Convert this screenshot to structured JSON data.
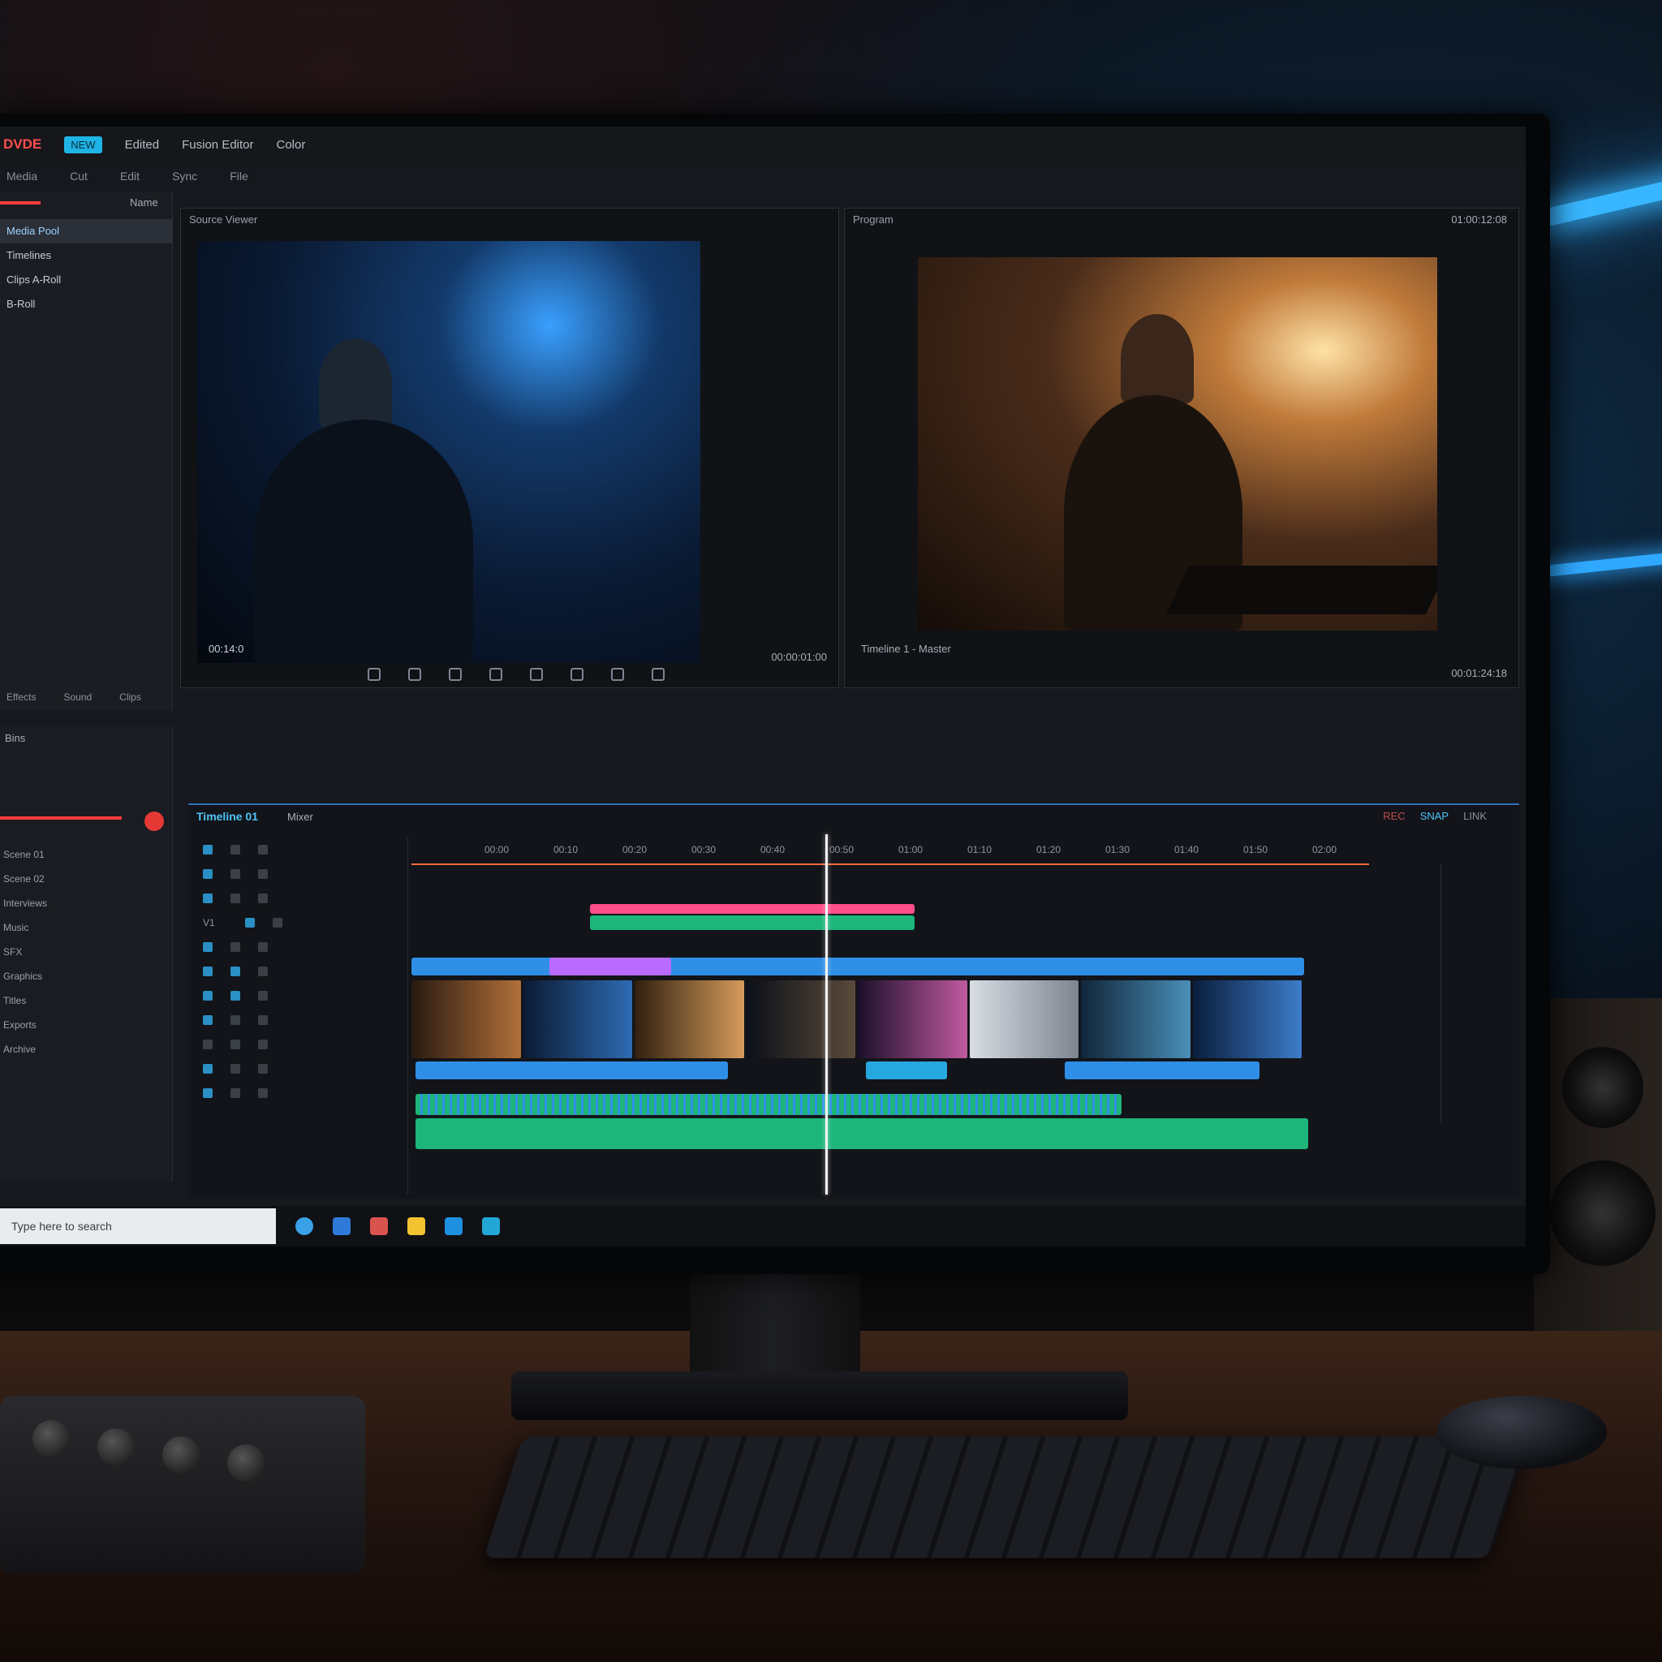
{
  "app": {
    "logo": "DVDE",
    "badge": "NEW",
    "menu": [
      "Edited",
      "Fusion Editor",
      "Color"
    ],
    "submenu": [
      "Media",
      "Cut",
      "Edit",
      "Sync",
      "File"
    ]
  },
  "left_panel": {
    "header": "Name",
    "items": [
      "Media Pool",
      "Timelines",
      "Clips A-Roll",
      "B-Roll"
    ],
    "bottom_tabs": [
      "Effects",
      "Sound",
      "Clips"
    ]
  },
  "source_viewer": {
    "title": "Source Viewer",
    "timecode": "00:14:0",
    "footer": "00:00:01:00"
  },
  "program_viewer": {
    "title": "Program",
    "timecode_top": "01:00:12:08",
    "footer_left": "Timeline 1 - Master",
    "footer_right": "00:01:24:18"
  },
  "timeline": {
    "tab_active": "Timeline 01",
    "tab_other": "Mixer",
    "track_label": "V1",
    "ruler_ticks": [
      "00:00",
      "00:10",
      "00:20",
      "00:30",
      "00:40",
      "00:50",
      "01:00",
      "01:10",
      "01:20",
      "01:30",
      "01:40",
      "01:50",
      "02:00"
    ],
    "tools": [
      "REC",
      "SNAP",
      "LINK"
    ],
    "clip_colors": {
      "pink": "#ff4f8b",
      "green": "#1db57a",
      "blue": "#2f8fe6",
      "purple": "#b96bff",
      "cyan": "#27a7e0"
    }
  },
  "bins": {
    "header": "Bins",
    "rows": [
      "Scene 01",
      "Scene 02",
      "Interviews",
      "Music",
      "SFX",
      "Graphics",
      "Titles",
      "Exports",
      "Archive"
    ]
  },
  "taskbar": {
    "search_placeholder": "Type here to search",
    "icons": [
      "edge-icon",
      "settings-icon",
      "store-icon",
      "files-icon",
      "app-icon",
      "photos-icon"
    ]
  }
}
